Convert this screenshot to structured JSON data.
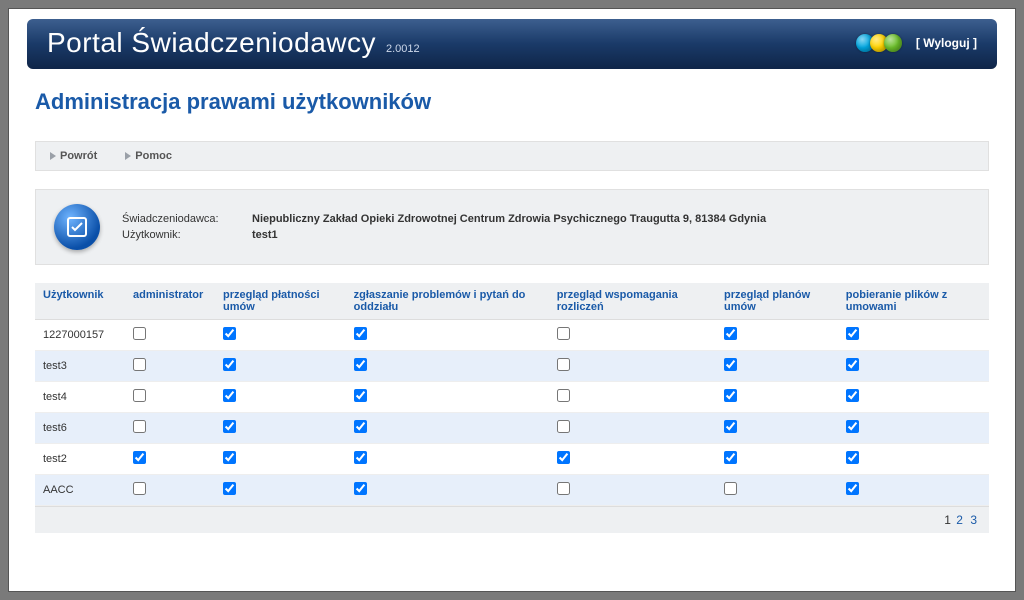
{
  "header": {
    "title": "Portal Świadczeniodawcy",
    "version": "2.0012",
    "logout": "[ Wyloguj ]",
    "orb_colors": [
      "#00a7e1",
      "#ffd400",
      "#6bbf2a"
    ]
  },
  "page_title": "Administracja prawami użytkowników",
  "nav": {
    "back": "Powrót",
    "help": "Pomoc"
  },
  "info": {
    "provider_label": "Świadczeniodawca:",
    "provider_value": "Niepubliczny Zakład Opieki Zdrowotnej Centrum Zdrowia Psychicznego Traugutta 9, 81384 Gdynia",
    "user_label": "Użytkownik:",
    "user_value": "test1"
  },
  "columns": [
    "Użytkownik",
    "administrator",
    "przegląd płatności umów",
    "zgłaszanie problemów i pytań do oddziału",
    "przegląd wspomagania rozliczeń",
    "przegląd planów umów",
    "pobieranie plików z umowami"
  ],
  "rows": [
    {
      "user": "1227000157",
      "checks": [
        false,
        true,
        true,
        false,
        true,
        true
      ]
    },
    {
      "user": "test3",
      "checks": [
        false,
        true,
        true,
        false,
        true,
        true
      ]
    },
    {
      "user": "test4",
      "checks": [
        false,
        true,
        true,
        false,
        true,
        true
      ]
    },
    {
      "user": "test6",
      "checks": [
        false,
        true,
        true,
        false,
        true,
        true
      ]
    },
    {
      "user": "test2",
      "checks": [
        true,
        true,
        true,
        true,
        true,
        true
      ]
    },
    {
      "user": "AACC",
      "checks": [
        false,
        true,
        true,
        false,
        false,
        true
      ]
    }
  ],
  "pager": {
    "current": "1",
    "p2": "2",
    "p3": "3"
  }
}
